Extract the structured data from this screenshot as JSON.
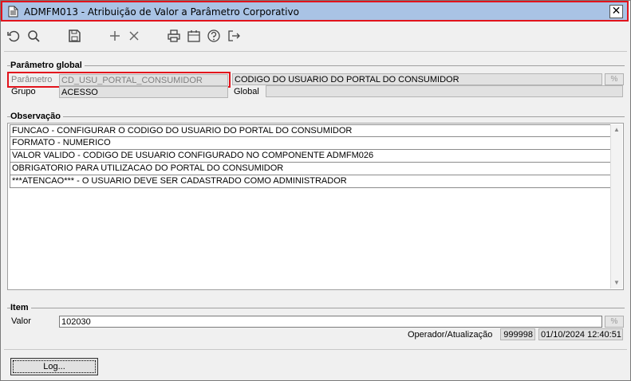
{
  "window": {
    "title": "ADMFM013 - Atribuição de Valor a Parâmetro Corporativo",
    "close_glyph": "✕"
  },
  "toolbar": {
    "icons": [
      "undo-icon",
      "search-icon",
      "save-icon",
      "add-icon",
      "delete-icon",
      "print-icon",
      "calendar-icon",
      "help-icon",
      "exit-icon"
    ]
  },
  "parametro_global": {
    "section_title": "Parâmetro global",
    "parametro_label": "Parâmetro",
    "parametro_value": "CD_USU_PORTAL_CONSUMIDOR",
    "parametro_description": "CODIGO DO USUARIO DO PORTAL DO CONSUMIDOR",
    "grupo_label": "Grupo",
    "grupo_value": "ACESSO",
    "global_label": "Global",
    "global_value": "",
    "lookup_glyph": "%"
  },
  "observacao": {
    "section_title": "Observação",
    "lines": [
      "FUNCAO - CONFIGURAR O CODIGO DO USUARIO DO PORTAL DO CONSUMIDOR",
      "FORMATO - NUMERICO",
      "VALOR VALIDO - CODIGO DE USUARIO CONFIGURADO NO COMPONENTE ADMFM026",
      "OBRIGATORIO PARA UTILIZACAO DO PORTAL DO CONSUMIDOR",
      "***ATENCAO*** - O USUARIO DEVE SER CADASTRADO COMO ADMINISTRADOR"
    ]
  },
  "item": {
    "section_title": "Item",
    "valor_label": "Valor",
    "valor_value": "102030",
    "operador_label": "Operador/Atualização",
    "operador_value": "999998",
    "atualizacao_value": "01/10/2024 12:40:51",
    "lookup_glyph": "%"
  },
  "buttons": {
    "log_label": "Log..."
  },
  "colors": {
    "titlebar": "#a9c3e5",
    "highlight": "#e2131c"
  }
}
